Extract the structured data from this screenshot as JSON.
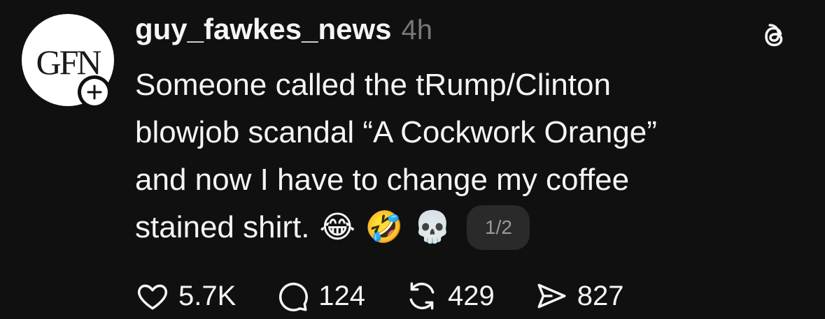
{
  "post": {
    "avatar_text": "GFN",
    "username": "guy_fawkes_news",
    "time": "4h",
    "text_lines": [
      "Someone called the tRump/Clinton",
      "blowjob scandal “A Cockwork Orange”",
      "and now I have to change my coffee",
      "stained shirt."
    ],
    "emojis": [
      "😂",
      "🤣",
      "💀"
    ],
    "page_indicator": "1/2"
  },
  "actions": {
    "likes": "5.7K",
    "comments": "124",
    "reposts": "429",
    "shares": "827"
  },
  "icons": {
    "follow": "plus-icon",
    "app": "threads-logo-icon",
    "like": "heart-icon",
    "comment": "comment-icon",
    "repost": "repost-icon",
    "share": "send-icon"
  }
}
